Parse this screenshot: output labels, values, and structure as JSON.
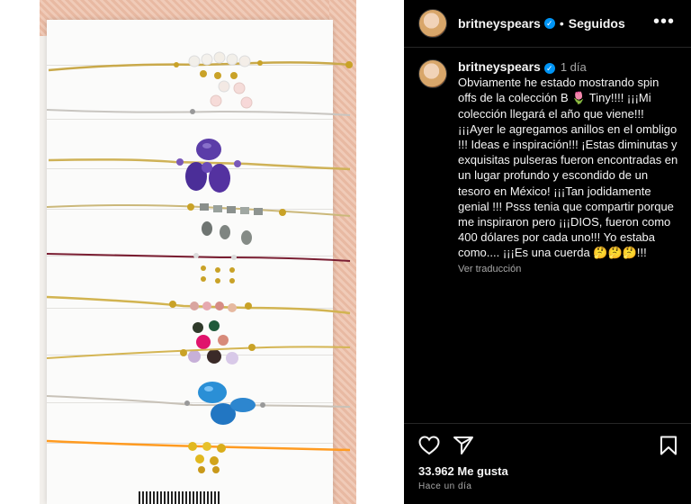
{
  "post": {
    "image_alt": "Pulseras con piedras de colores sobre tarjeta blanca",
    "beads_colors": [
      "#c9a227",
      "#7b4fc8",
      "#4a9bd8",
      "#e23b8a",
      "#ff9b21"
    ]
  },
  "header": {
    "username": "britneyspears",
    "verified_mark": "✓",
    "separator": "•",
    "follow_status": "Seguidos",
    "more_icon": "•••"
  },
  "caption": {
    "username": "britneyspears",
    "verified_mark": "✓",
    "time": "1 día",
    "text": "Obviamente he estado mostrando spin offs de la colección B 🌷 Tiny!!!! ¡¡¡Mi colección llegará el año que viene!!! ¡¡¡Ayer le agregamos anillos en el ombligo !!! Ideas e inspiración!!! ¡Estas diminutas y exquisitas pulseras fueron encontradas en un lugar profundo y escondido de un tesoro en México! ¡¡¡Tan jodidamente genial !!! Psss tenia que compartir porque me inspiraron pero ¡¡¡DIOS, fueron como 400 dólares por cada uno!!! Yo estaba como.... ¡¡¡Es una cuerda 🤔🤔🤔!!!",
    "translate_label": "Ver traducción"
  },
  "footer": {
    "likes": "33.962 Me gusta",
    "posted_ago": "Hace un día"
  },
  "colors": {
    "panel_bg": "#000000",
    "verified": "#0095f6",
    "muted_text": "#a8a8a8"
  },
  "icons": [
    "heart-icon",
    "share-icon",
    "bookmark-icon",
    "more-options-icon",
    "verified-badge-icon"
  ]
}
